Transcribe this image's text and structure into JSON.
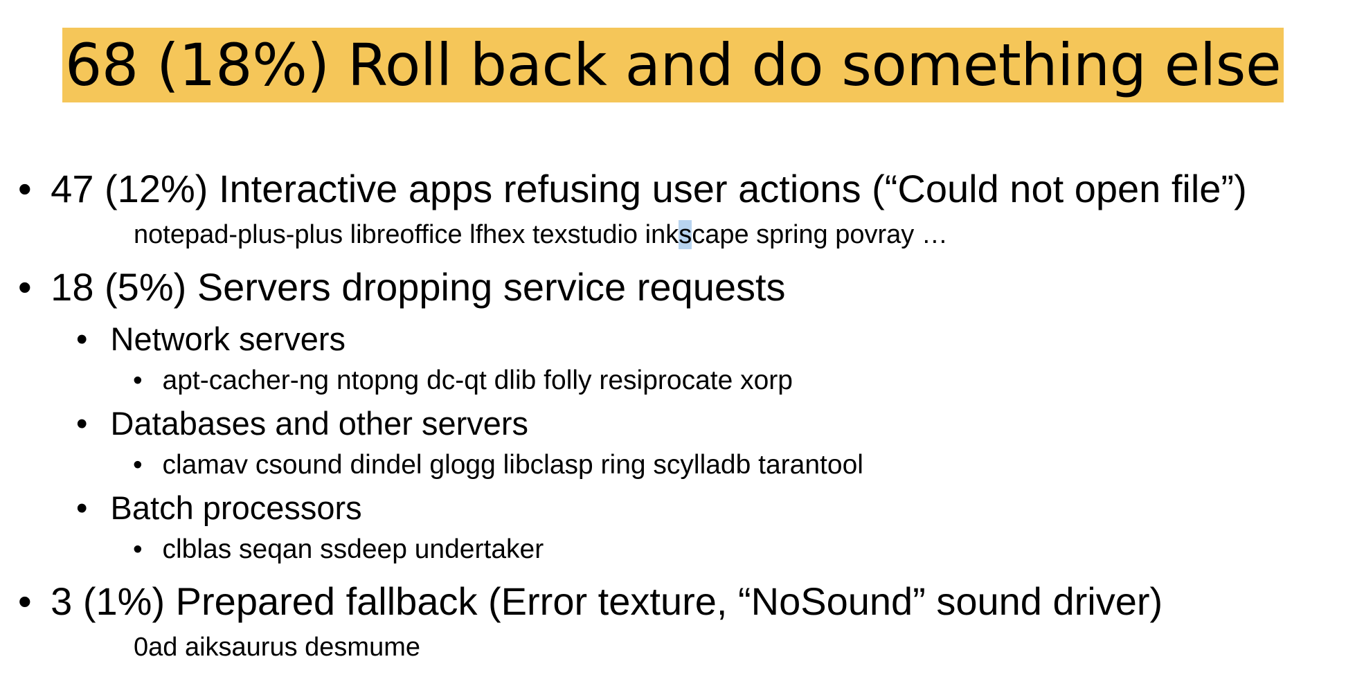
{
  "slide": {
    "title": "68 (18%) Roll back and do something else",
    "title_bg_color": "#f5c659",
    "bullet_glyph": "•",
    "items": [
      {
        "heading": "47 (12%) Interactive apps refusing user actions (“Could not open file”)",
        "examples_before": "notepad-plus-plus libreoffice lfhex texstudio ink",
        "examples_highlight": "s",
        "examples_after": "cape spring povray …"
      },
      {
        "heading": "18 (5%) Servers dropping service requests",
        "groups": [
          {
            "label": "Network servers",
            "examples": "apt-cacher-ng ntopng dc-qt dlib folly resiprocate xorp"
          },
          {
            "label": "Databases and other servers",
            "examples": "clamav csound dindel glogg libclasp ring scylladb tarantool"
          },
          {
            "label": "Batch processors",
            "examples": "clblas seqan ssdeep undertaker"
          }
        ]
      },
      {
        "heading": "3 (1%) Prepared fallback (Error texture, “NoSound” sound driver)",
        "examples": "0ad aiksaurus desmume"
      }
    ]
  }
}
